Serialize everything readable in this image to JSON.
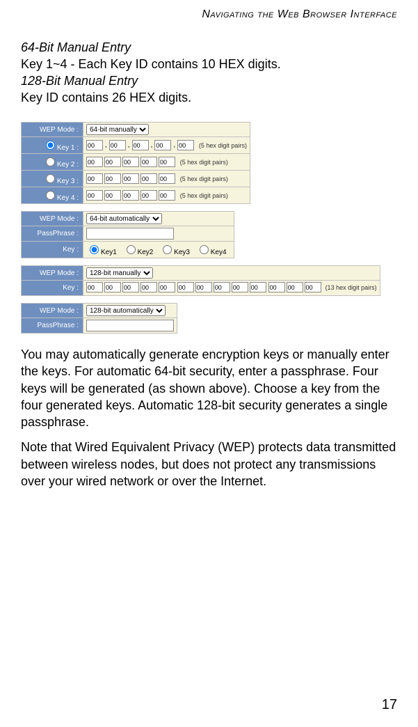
{
  "running_head": "Navigating the Web Browser Interface",
  "sec64_title": "64-Bit Manual Entry",
  "sec64_body": "Key 1~4 - Each Key ID contains 10 HEX digits.",
  "sec128_title": "128-Bit Manual Entry",
  "sec128_body": "Key ID contains 26 HEX digits.",
  "tab1": {
    "wep_mode_label": "WEP Mode :",
    "wep_mode_value": "64-bit manually",
    "note": "(5 hex digit pairs)",
    "rows": [
      {
        "label": "Key 1 :",
        "radio": true,
        "checked": true
      },
      {
        "label": "Key 2 :",
        "radio": true,
        "checked": false
      },
      {
        "label": "Key 3 :",
        "radio": true,
        "checked": false
      },
      {
        "label": "Key 4 :",
        "radio": true,
        "checked": false
      }
    ],
    "hex_default": "00"
  },
  "tab2": {
    "wep_mode_label": "WEP Mode :",
    "wep_mode_value": "64-bit automatically",
    "pass_label": "PassPhrase :",
    "key_label": "Key :",
    "opts": [
      "Key1",
      "Key2",
      "Key3",
      "Key4"
    ]
  },
  "tab3": {
    "wep_mode_label": "WEP Mode :",
    "wep_mode_value": "128-bit manually",
    "key_label": "Key :",
    "note": "(13 hex digit pairs)",
    "hex_default": "00"
  },
  "tab4": {
    "wep_mode_label": "WEP Mode :",
    "wep_mode_value": "128-bit automatically",
    "pass_label": "PassPhrase :"
  },
  "para1": "You may automatically generate encryption keys or manually enter the keys. For automatic 64-bit security, enter a passphrase. Four keys will be generated (as shown above). Choose a key from the four generated keys. Automatic 128-bit security generates a single passphrase.",
  "para2": "Note that Wired Equivalent Privacy (WEP) protects data transmitted between wireless nodes, but does not protect any transmissions over your wired network or over the Internet.",
  "page_number": "17"
}
